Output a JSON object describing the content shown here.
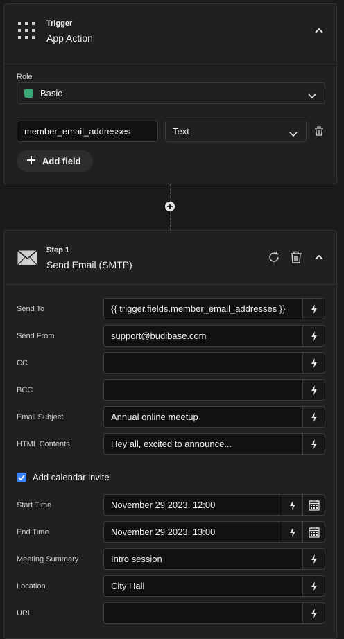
{
  "trigger": {
    "kicker": "Trigger",
    "title": "App Action",
    "role_label": "Role",
    "role_value": "Basic",
    "role_color": "#3aa876",
    "field_name": "member_email_addresses",
    "field_type": "Text",
    "add_field_label": "Add field"
  },
  "step": {
    "kicker": "Step 1",
    "title": "Send Email (SMTP)",
    "fields": [
      {
        "label": "Send To",
        "value": "{{ trigger.fields.member_email_addresses }}"
      },
      {
        "label": "Send From",
        "value": "support@budibase.com"
      },
      {
        "label": "CC",
        "value": ""
      },
      {
        "label": "BCC",
        "value": ""
      },
      {
        "label": "Email Subject",
        "value": "Annual online meetup"
      },
      {
        "label": "HTML Contents",
        "value": "Hey all, excited to announce..."
      }
    ],
    "calendar_invite_label": "Add calendar invite",
    "calendar_invite_checked": true,
    "calendar_fields": [
      {
        "label": "Start Time",
        "value": "November 29 2023, 12:00"
      },
      {
        "label": "End Time",
        "value": "November 29 2023, 13:00"
      }
    ],
    "extra_fields": [
      {
        "label": "Meeting Summary",
        "value": "Intro session"
      },
      {
        "label": "Location",
        "value": "City Hall"
      },
      {
        "label": "URL",
        "value": ""
      }
    ]
  },
  "icons": {
    "trigger": "grid-dots-icon",
    "step": "mail-icon",
    "binding": "lightning-bolt-icon",
    "calendar": "calendar-icon"
  },
  "colors": {
    "accent": "#3b82f6",
    "background": "#1a1a1a",
    "card": "#202020"
  }
}
